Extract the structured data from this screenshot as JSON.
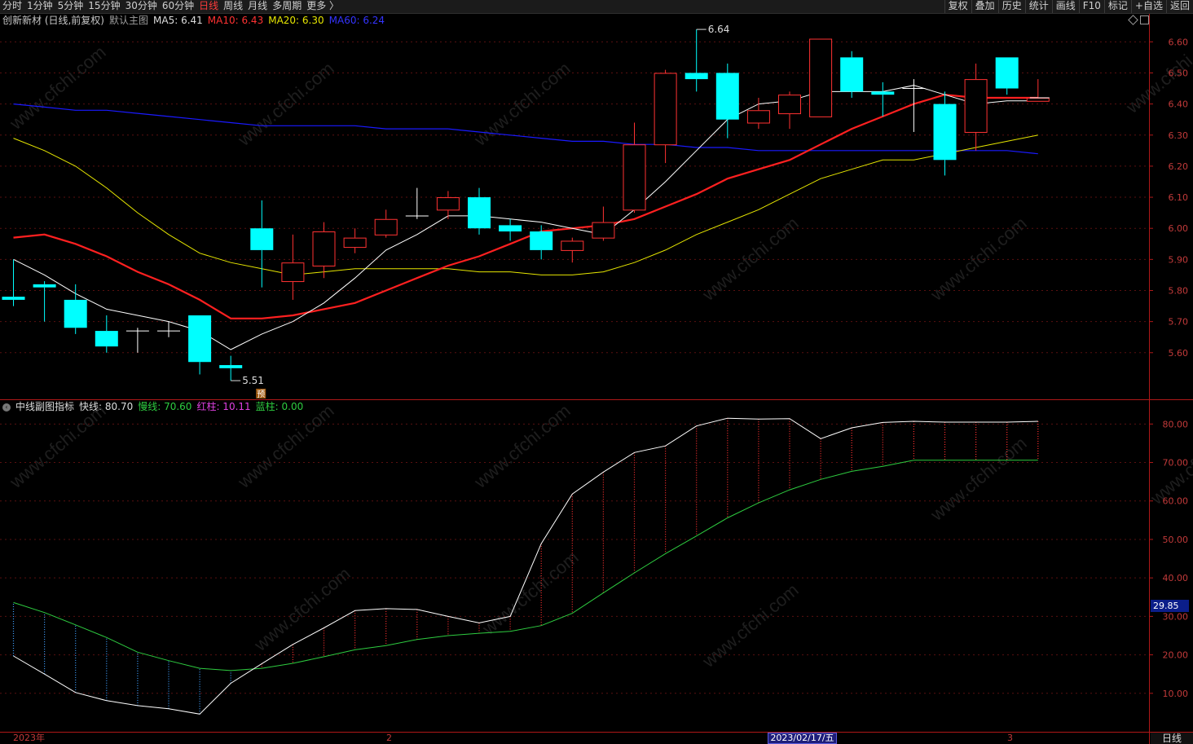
{
  "toolbar": {
    "periods": [
      "分时",
      "1分钟",
      "5分钟",
      "15分钟",
      "30分钟",
      "60分钟",
      "日线",
      "周线",
      "月线",
      "多周期",
      "更多 〉"
    ],
    "active_period": "日线",
    "tools": [
      "复权",
      "叠加",
      "历史",
      "统计",
      "画线",
      "F10",
      "标记",
      "+自选",
      "返回"
    ]
  },
  "main_legend": {
    "stock": "创新新材 (日线,前复权)",
    "indicator": "默认主图",
    "ma5": "MA5: 6.41",
    "ma10": "MA10: 6.43",
    "ma20": "MA20: 6.30",
    "ma60": "MA60: 6.24"
  },
  "sub_legend": {
    "name": "中线副图指标",
    "fast": "快线: 80.70",
    "slow": "慢线: 70.60",
    "red": "红柱: 10.11",
    "blue": "蓝柱: 0.00"
  },
  "price_axis": [
    "6.60",
    "6.50",
    "6.40",
    "6.30",
    "6.20",
    "6.10",
    "6.00",
    "5.90",
    "5.80",
    "5.70",
    "5.60"
  ],
  "sub_axis": [
    "80.00",
    "70.00",
    "60.00",
    "50.00",
    "40.00",
    "30.00",
    "20.00",
    "10.00"
  ],
  "cursor_value": "29.85",
  "annotations": {
    "high": "6.64",
    "low": "5.51",
    "forecast": "预"
  },
  "dates": {
    "year": "2023年",
    "feb": "2",
    "cursor": "2023/02/17/五",
    "mar": "3"
  },
  "corner": "日线",
  "watermark": "www.cfchi.com",
  "colors": {
    "up": "#ff3232",
    "down": "#00ffff",
    "ma5": "#ffffff",
    "ma10": "#ff2020",
    "ma20": "#e6e600",
    "ma60": "#1a1aff",
    "slow": "#2ecc40"
  },
  "chart_data": {
    "type": "candlestick",
    "candles": [
      {
        "o": 5.78,
        "c": 5.77,
        "h": 5.9,
        "l": 5.75
      },
      {
        "o": 5.82,
        "c": 5.81,
        "h": 5.83,
        "l": 5.7
      },
      {
        "o": 5.77,
        "c": 5.68,
        "h": 5.82,
        "l": 5.66
      },
      {
        "o": 5.67,
        "c": 5.62,
        "h": 5.72,
        "l": 5.6
      },
      {
        "o": 5.67,
        "c": 5.67,
        "h": 5.68,
        "l": 5.6
      },
      {
        "o": 5.67,
        "c": 5.67,
        "h": 5.7,
        "l": 5.65
      },
      {
        "o": 5.72,
        "c": 5.57,
        "h": 5.72,
        "l": 5.53
      },
      {
        "o": 5.56,
        "c": 5.55,
        "h": 5.59,
        "l": 5.51
      },
      {
        "o": 6.0,
        "c": 5.93,
        "h": 6.09,
        "l": 5.81
      },
      {
        "o": 5.83,
        "c": 5.89,
        "h": 5.98,
        "l": 5.77
      },
      {
        "o": 5.88,
        "c": 5.99,
        "h": 6.02,
        "l": 5.84
      },
      {
        "o": 5.94,
        "c": 5.97,
        "h": 6.0,
        "l": 5.92
      },
      {
        "o": 5.98,
        "c": 6.03,
        "h": 6.06,
        "l": 5.97
      },
      {
        "o": 6.04,
        "c": 6.04,
        "h": 6.13,
        "l": 6.03
      },
      {
        "o": 6.06,
        "c": 6.1,
        "h": 6.12,
        "l": 6.03
      },
      {
        "o": 6.1,
        "c": 6.0,
        "h": 6.13,
        "l": 5.98
      },
      {
        "o": 6.01,
        "c": 5.99,
        "h": 6.03,
        "l": 5.96
      },
      {
        "o": 5.99,
        "c": 5.93,
        "h": 6.01,
        "l": 5.9
      },
      {
        "o": 5.93,
        "c": 5.96,
        "h": 5.97,
        "l": 5.89
      },
      {
        "o": 5.97,
        "c": 6.02,
        "h": 6.07,
        "l": 5.96
      },
      {
        "o": 6.06,
        "c": 6.27,
        "h": 6.34,
        "l": 6.05
      },
      {
        "o": 6.27,
        "c": 6.5,
        "h": 6.51,
        "l": 6.21
      },
      {
        "o": 6.5,
        "c": 6.48,
        "h": 6.64,
        "l": 6.44
      },
      {
        "o": 6.5,
        "c": 6.35,
        "h": 6.53,
        "l": 6.29
      },
      {
        "o": 6.34,
        "c": 6.38,
        "h": 6.42,
        "l": 6.32
      },
      {
        "o": 6.37,
        "c": 6.43,
        "h": 6.44,
        "l": 6.32
      },
      {
        "o": 6.36,
        "c": 6.61,
        "h": 6.61,
        "l": 6.36
      },
      {
        "o": 6.55,
        "c": 6.44,
        "h": 6.57,
        "l": 6.42
      },
      {
        "o": 6.44,
        "c": 6.43,
        "h": 6.47,
        "l": 6.36
      },
      {
        "o": 6.45,
        "c": 6.45,
        "h": 6.48,
        "l": 6.31
      },
      {
        "o": 6.4,
        "c": 6.22,
        "h": 6.44,
        "l": 6.17
      },
      {
        "o": 6.31,
        "c": 6.48,
        "h": 6.53,
        "l": 6.25
      },
      {
        "o": 6.55,
        "c": 6.45,
        "h": 6.55,
        "l": 6.43
      },
      {
        "o": 6.41,
        "c": 6.42,
        "h": 6.48,
        "l": 6.41
      }
    ],
    "ma5": [
      5.9,
      5.85,
      5.79,
      5.74,
      5.72,
      5.7,
      5.67,
      5.61,
      5.66,
      5.7,
      5.76,
      5.84,
      5.93,
      5.98,
      6.04,
      6.04,
      6.03,
      6.02,
      6.0,
      5.98,
      6.06,
      6.15,
      6.25,
      6.35,
      6.4,
      6.41,
      6.44,
      6.44,
      6.44,
      6.46,
      6.43,
      6.4,
      6.41,
      6.41
    ],
    "ma10": [
      5.97,
      5.98,
      5.95,
      5.91,
      5.86,
      5.82,
      5.77,
      5.71,
      5.71,
      5.72,
      5.74,
      5.76,
      5.8,
      5.84,
      5.88,
      5.91,
      5.95,
      5.99,
      6.0,
      6.01,
      6.03,
      6.07,
      6.11,
      6.16,
      6.19,
      6.22,
      6.27,
      6.32,
      6.36,
      6.4,
      6.43,
      6.42,
      6.42,
      6.42
    ],
    "ma20": [
      6.29,
      6.25,
      6.2,
      6.13,
      6.05,
      5.98,
      5.92,
      5.89,
      5.87,
      5.85,
      5.86,
      5.87,
      5.87,
      5.87,
      5.87,
      5.86,
      5.86,
      5.85,
      5.85,
      5.86,
      5.89,
      5.93,
      5.98,
      6.02,
      6.06,
      6.11,
      6.16,
      6.19,
      6.22,
      6.22,
      6.24,
      6.26,
      6.28,
      6.3
    ],
    "ma60": [
      6.4,
      6.39,
      6.38,
      6.38,
      6.37,
      6.36,
      6.35,
      6.34,
      6.33,
      6.33,
      6.33,
      6.33,
      6.32,
      6.32,
      6.32,
      6.31,
      6.3,
      6.29,
      6.28,
      6.28,
      6.27,
      6.27,
      6.26,
      6.26,
      6.25,
      6.25,
      6.25,
      6.25,
      6.25,
      6.25,
      6.25,
      6.25,
      6.25,
      6.24
    ],
    "fast": [
      19.7,
      15.0,
      10.2,
      8.1,
      6.8,
      6.0,
      4.6,
      12.6,
      17.7,
      22.7,
      27.0,
      31.5,
      32.0,
      31.8,
      30.0,
      28.3,
      30.0,
      48.9,
      61.8,
      67.5,
      72.6,
      74.3,
      79.5,
      81.5,
      81.3,
      81.4,
      76.2,
      79.0,
      80.4,
      80.7,
      80.5,
      80.5,
      80.5,
      80.7
    ],
    "slow": [
      33.6,
      31.0,
      27.8,
      24.5,
      20.7,
      18.5,
      16.5,
      15.9,
      16.5,
      17.8,
      19.5,
      21.3,
      22.4,
      24.0,
      25.0,
      25.6,
      26.1,
      27.6,
      30.8,
      36.1,
      41.3,
      46.3,
      50.9,
      55.6,
      59.5,
      62.9,
      65.6,
      67.7,
      69.0,
      70.6,
      70.6,
      70.6,
      70.6,
      70.6
    ],
    "price_range": [
      5.45,
      6.69
    ],
    "sub_range": [
      0,
      86
    ]
  }
}
